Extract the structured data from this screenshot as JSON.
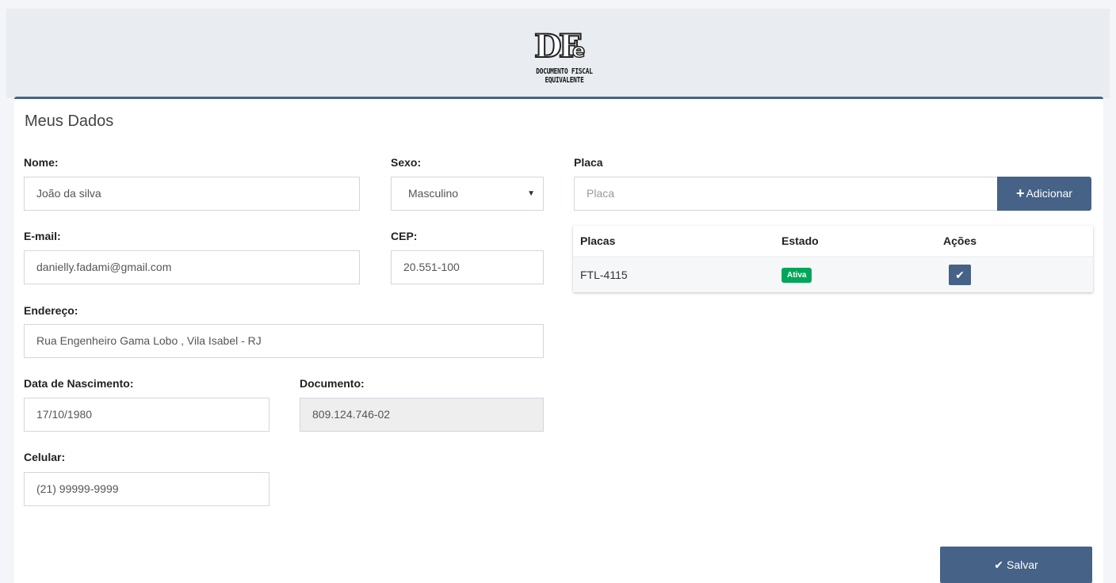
{
  "logo": {
    "mark": "DF",
    "mark_e": "e",
    "line1": "DOCUMENTO FISCAL",
    "line2": "EQUIVALENTE"
  },
  "card": {
    "title": "Meus Dados"
  },
  "form": {
    "nome": {
      "label": "Nome:",
      "value": "João da silva"
    },
    "sexo": {
      "label": "Sexo:",
      "value": "Masculino"
    },
    "email": {
      "label": "E-mail:",
      "value": "danielly.fadami@gmail.com"
    },
    "cep": {
      "label": "CEP:",
      "value": "20.551-100"
    },
    "endereco": {
      "label": "Endereço:",
      "value": "Rua Engenheiro Gama Lobo , Vila Isabel - RJ"
    },
    "nascimento": {
      "label": "Data de Nascimento:",
      "value": "17/10/1980"
    },
    "documento": {
      "label": "Documento:",
      "value": "809.124.746-02"
    },
    "celular": {
      "label": "Celular:",
      "value": "(21) 99999-9999"
    }
  },
  "placa": {
    "label": "Placa",
    "placeholder": "Placa",
    "add_icon": "plus-icon",
    "add_label": "Adicionar"
  },
  "table": {
    "headers": [
      "Placas",
      "Estado",
      "Ações"
    ],
    "rows": [
      {
        "placa": "FTL-4115",
        "estado": "Ativa",
        "action_icon": "check-icon"
      }
    ]
  },
  "save": {
    "icon": "check-icon",
    "label": "Salvar"
  },
  "colors": {
    "primary": "#466286",
    "success": "#00a65a",
    "header_bg": "#e9ecf1"
  }
}
